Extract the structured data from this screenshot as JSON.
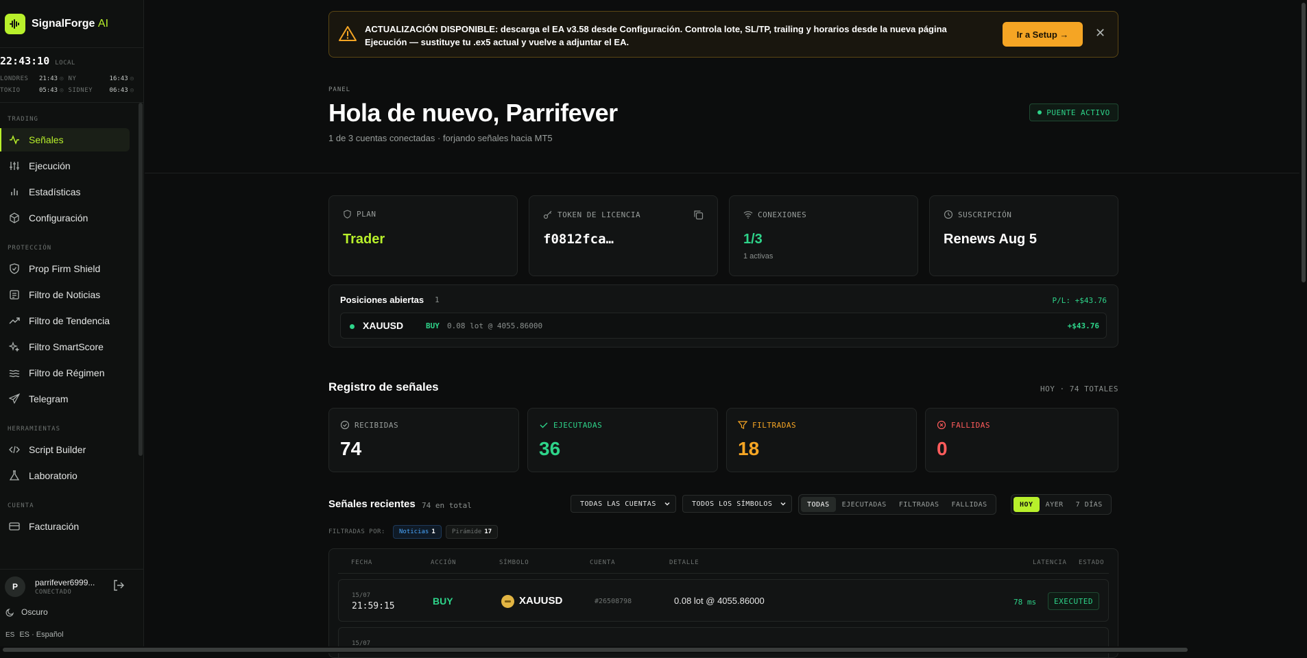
{
  "brand": {
    "name": "SignalForge",
    "suffix": "AI"
  },
  "clock": {
    "time": "22:43:10",
    "label": "LOCAL",
    "zones": [
      {
        "label": "LONDRES",
        "time": "21:43"
      },
      {
        "label": "NY",
        "time": "16:43"
      },
      {
        "label": "TOKIO",
        "time": "05:43"
      },
      {
        "label": "SIDNEY",
        "time": "06:43"
      }
    ]
  },
  "nav": {
    "trading": "TRADING",
    "signals": "Señales",
    "execution": "Ejecución",
    "stats": "Estadísticas",
    "config": "Configuración",
    "protection": "PROTECCIÓN",
    "prop_shield": "Prop Firm Shield",
    "news_filter": "Filtro de Noticias",
    "trend_filter": "Filtro de Tendencia",
    "smartscore_filter": "Filtro SmartScore",
    "regime_filter": "Filtro de Régimen",
    "telegram": "Telegram",
    "tools": "HERRAMIENTAS",
    "script_builder": "Script Builder",
    "lab": "Laboratorio",
    "account": "CUENTA",
    "billing": "Facturación"
  },
  "user": {
    "initial": "P",
    "name": "parrifever6999...",
    "status": "CONECTADO"
  },
  "theme": {
    "label": "Oscuro"
  },
  "language": {
    "code": "ES",
    "label": "ES · Español"
  },
  "banner": {
    "text": "ACTUALIZACIÓN DISPONIBLE: descarga el EA v3.58 desde Configuración. Controla lote, SL/TP, trailing y horarios desde la nueva página Ejecución — sustituye tu .ex5 actual y vuelve a adjuntar el EA.",
    "button": "Ir a Setup →",
    "close": "✕"
  },
  "header": {
    "eyebrow": "PANEL",
    "title": "Hola de nuevo, Parrifever",
    "subtitle": "1 de 3 cuentas conectadas · forjando señales hacia MT5",
    "bridge": "PUENTE ACTIVO"
  },
  "stats": {
    "plan": {
      "label": "PLAN",
      "value": "Trader"
    },
    "token": {
      "label": "TOKEN DE LICENCIA",
      "value": "f0812fca…"
    },
    "connections": {
      "label": "CONEXIONES",
      "value": "1/3",
      "sub": "1 activas"
    },
    "subscription": {
      "label": "SUSCRIPCIÓN",
      "value": "Renews Aug 5"
    }
  },
  "positions": {
    "title": "Posiciones abiertas",
    "count": "1",
    "pl": "P/L: +$43.76",
    "rows": [
      {
        "symbol": "XAUUSD",
        "side": "BUY",
        "detail": "0.08 lot  @ 4055.86000",
        "pnl": "+$43.76"
      }
    ]
  },
  "log": {
    "title": "Registro de señales",
    "meta": "HOY · 74 TOTALES",
    "received": {
      "label": "RECIBIDAS",
      "value": "74"
    },
    "executed": {
      "label": "EJECUTADAS",
      "value": "36"
    },
    "filtered": {
      "label": "FILTRADAS",
      "value": "18"
    },
    "failed": {
      "label": "FALLIDAS",
      "value": "0"
    }
  },
  "recent": {
    "title": "Señales recientes",
    "total": "74 en total",
    "account_select": "TODAS LAS CUENTAS",
    "symbol_select": "TODOS LOS SÍMBOLOS",
    "status_tabs": [
      "TODAS",
      "EJECUTADAS",
      "FILTRADAS",
      "FALLIDAS"
    ],
    "range_tabs": [
      "HOY",
      "AYER",
      "7 DÍAS"
    ],
    "filtered_by": "FILTRADAS POR:",
    "chips": [
      {
        "label": "Noticias",
        "count": "1"
      },
      {
        "label": "Pirámide",
        "count": "17"
      }
    ],
    "columns": [
      "FECHA",
      "ACCIÓN",
      "SÍMBOLO",
      "CUENTA",
      "DETALLE",
      "LATENCIA",
      "ESTADO"
    ],
    "rows": [
      {
        "date": "15/07",
        "time": "21:59:15",
        "action": "BUY",
        "symbol": "XAUUSD",
        "account": "#26508798",
        "detail": "0.08 lot @ 4055.86000",
        "latency": "78 ms",
        "status": "EXECUTED"
      },
      {
        "date": "15/07"
      }
    ]
  },
  "colors": {
    "accent": "#b8f02b",
    "success": "#2ed48a",
    "warning": "#f5a524",
    "danger": "#ff5c5c",
    "info": "#4aa8ff"
  }
}
